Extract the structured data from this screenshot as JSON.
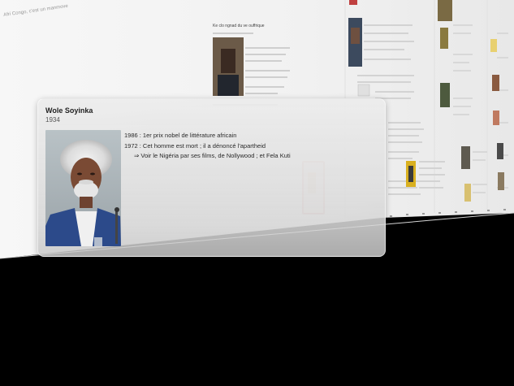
{
  "background_page": {
    "header_text": "Afri Congo, c'est un manmove",
    "section_title": "Ke clo ngnad du ve ouffrique",
    "accent_color": "#f0f0f0"
  },
  "card": {
    "name": "Wole Soyinka",
    "year": "1934",
    "lines": [
      "1986 : 1er prix nobel de littérature africain",
      "1972 : Cet homme est mort ; il a dénoncé l'apartheid",
      "⇒ Voir le Nigéria par ses films, de Nollywood ; et Fela Kuti"
    ],
    "portrait_icon": "portrait-photo"
  }
}
